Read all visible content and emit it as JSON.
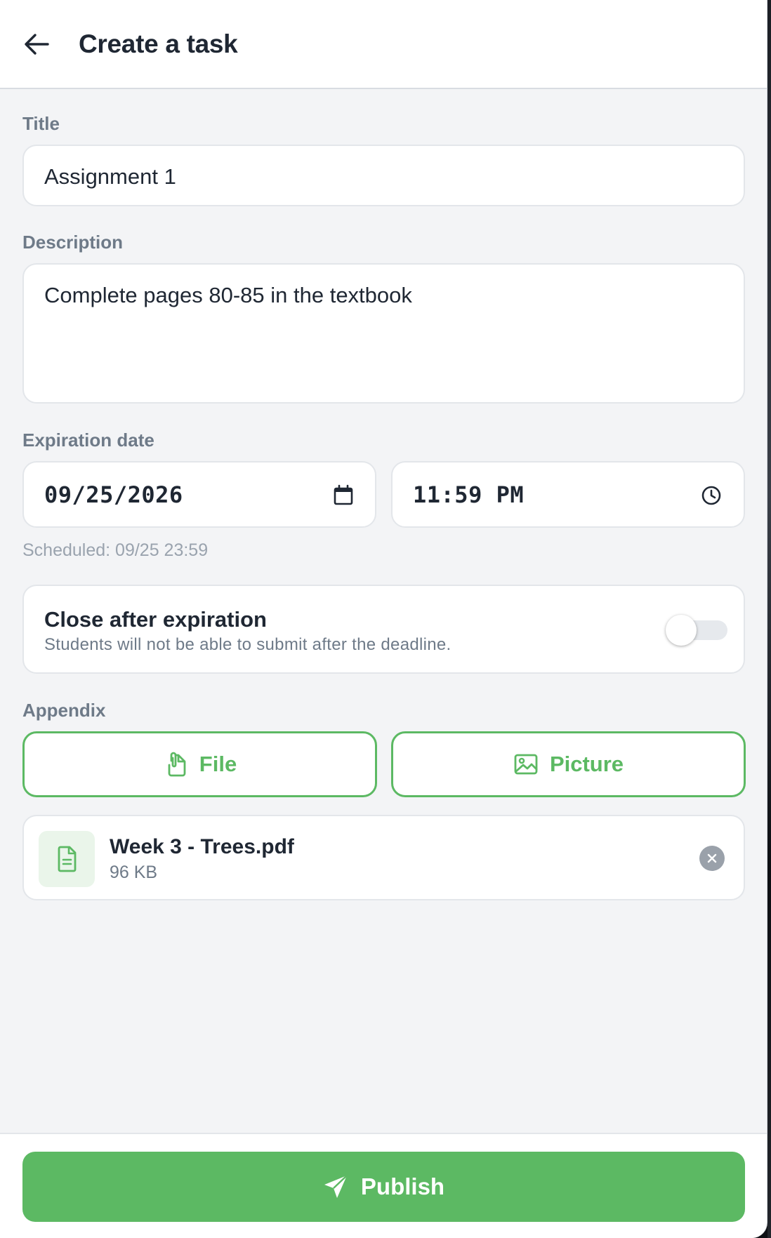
{
  "header": {
    "back_icon": "arrow-left-icon",
    "title": "Create a task"
  },
  "form": {
    "title_label": "Title",
    "title_value": "Assignment 1",
    "description_label": "Description",
    "description_value": "Complete pages 80-85 in the textbook",
    "expiration_label": "Expiration date",
    "date_value": "09/25/2026",
    "date_icon": "calendar-icon",
    "time_value": "11:59 PM",
    "time_icon": "clock-icon",
    "scheduled_text": "Scheduled: 09/25 23:59"
  },
  "close_after": {
    "title": "Close after expiration",
    "subtitle": "Students will not be able to submit after the deadline.",
    "enabled": false
  },
  "appendix": {
    "label": "Appendix",
    "file_button": {
      "label": "File",
      "icon": "paperclip-file-icon"
    },
    "picture_button": {
      "label": "Picture",
      "icon": "image-icon"
    },
    "attachments": [
      {
        "name": "Week 3 - Trees.pdf",
        "size": "96 KB",
        "icon": "document-icon"
      }
    ]
  },
  "footer": {
    "publish_label": "Publish",
    "publish_icon": "send-icon"
  },
  "colors": {
    "accent": "#5cb963",
    "background": "#f3f4f6",
    "text": "#1f2733",
    "muted": "#6e7a88"
  }
}
